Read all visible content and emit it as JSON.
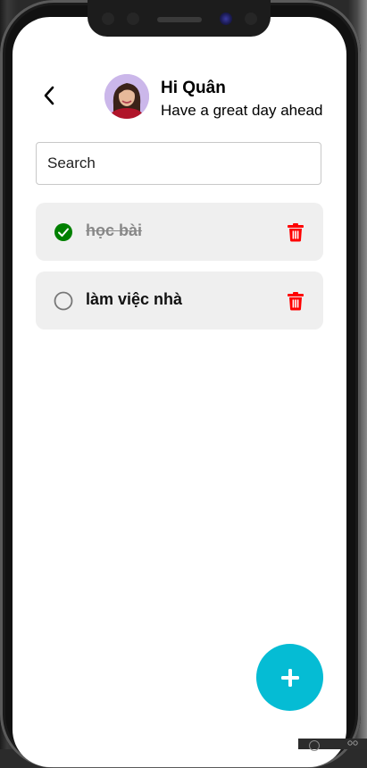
{
  "header": {
    "greeting_title": "Hi Quân",
    "greeting_subtitle": "Have a great day ahead"
  },
  "search": {
    "placeholder": "Search",
    "value": ""
  },
  "todos": [
    {
      "text": "học bài",
      "done": true
    },
    {
      "text": "làm việc nhà",
      "done": false
    }
  ],
  "icons": {
    "back": "back-arrow-icon",
    "check_done": "check-circle-icon",
    "check_empty": "empty-circle-icon",
    "delete": "trash-icon",
    "add": "plus-icon"
  },
  "colors": {
    "accent_fab": "#05bcd4",
    "done_check": "#008000",
    "delete_red": "#ff0000",
    "item_bg": "#efefef"
  }
}
